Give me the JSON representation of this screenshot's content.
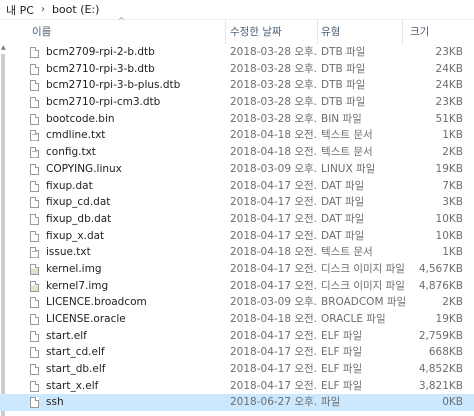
{
  "breadcrumb": [
    "내 PC",
    "boot (E:)"
  ],
  "columns": {
    "name": "이름",
    "date": "수정한 날짜",
    "type": "유형",
    "size": "크기"
  },
  "files": [
    {
      "name": "bcm2709-rpi-2-b.dtb",
      "date": "2018-03-28 오후...",
      "type": "DTB 파일",
      "size": "23KB",
      "icon": "file-icon"
    },
    {
      "name": "bcm2710-rpi-3-b.dtb",
      "date": "2018-03-28 오후...",
      "type": "DTB 파일",
      "size": "24KB",
      "icon": "file-icon"
    },
    {
      "name": "bcm2710-rpi-3-b-plus.dtb",
      "date": "2018-03-28 오후...",
      "type": "DTB 파일",
      "size": "24KB",
      "icon": "file-icon"
    },
    {
      "name": "bcm2710-rpi-cm3.dtb",
      "date": "2018-03-28 오후...",
      "type": "DTB 파일",
      "size": "23KB",
      "icon": "file-icon"
    },
    {
      "name": "bootcode.bin",
      "date": "2018-03-28 오후...",
      "type": "BIN 파일",
      "size": "51KB",
      "icon": "file-icon"
    },
    {
      "name": "cmdline.txt",
      "date": "2018-04-18 오전...",
      "type": "텍스트 문서",
      "size": "1KB",
      "icon": "text-file-icon"
    },
    {
      "name": "config.txt",
      "date": "2018-04-18 오전...",
      "type": "텍스트 문서",
      "size": "2KB",
      "icon": "text-file-icon"
    },
    {
      "name": "COPYING.linux",
      "date": "2018-03-09 오후...",
      "type": "LINUX 파일",
      "size": "19KB",
      "icon": "file-icon"
    },
    {
      "name": "fixup.dat",
      "date": "2018-04-17 오전...",
      "type": "DAT 파일",
      "size": "7KB",
      "icon": "file-icon"
    },
    {
      "name": "fixup_cd.dat",
      "date": "2018-04-17 오전...",
      "type": "DAT 파일",
      "size": "3KB",
      "icon": "file-icon"
    },
    {
      "name": "fixup_db.dat",
      "date": "2018-04-17 오전...",
      "type": "DAT 파일",
      "size": "10KB",
      "icon": "file-icon"
    },
    {
      "name": "fixup_x.dat",
      "date": "2018-04-17 오전...",
      "type": "DAT 파일",
      "size": "10KB",
      "icon": "file-icon"
    },
    {
      "name": "issue.txt",
      "date": "2018-04-18 오전...",
      "type": "텍스트 문서",
      "size": "1KB",
      "icon": "text-file-icon"
    },
    {
      "name": "kernel.img",
      "date": "2018-04-17 오전...",
      "type": "디스크 이미지 파일",
      "size": "4,567KB",
      "icon": "image-file-icon"
    },
    {
      "name": "kernel7.img",
      "date": "2018-04-17 오전...",
      "type": "디스크 이미지 파일",
      "size": "4,876KB",
      "icon": "image-file-icon"
    },
    {
      "name": "LICENCE.broadcom",
      "date": "2018-03-09 오후...",
      "type": "BROADCOM 파일",
      "size": "2KB",
      "icon": "file-icon"
    },
    {
      "name": "LICENSE.oracle",
      "date": "2018-04-18 오전...",
      "type": "ORACLE 파일",
      "size": "19KB",
      "icon": "file-icon"
    },
    {
      "name": "start.elf",
      "date": "2018-04-17 오전...",
      "type": "ELF 파일",
      "size": "2,759KB",
      "icon": "file-icon"
    },
    {
      "name": "start_cd.elf",
      "date": "2018-04-17 오전...",
      "type": "ELF 파일",
      "size": "668KB",
      "icon": "file-icon"
    },
    {
      "name": "start_db.elf",
      "date": "2018-04-17 오전...",
      "type": "ELF 파일",
      "size": "4,852KB",
      "icon": "file-icon"
    },
    {
      "name": "start_x.elf",
      "date": "2018-04-17 오전...",
      "type": "ELF 파일",
      "size": "3,821KB",
      "icon": "file-icon"
    },
    {
      "name": "ssh",
      "date": "2018-06-27 오후...",
      "type": "파일",
      "size": "0KB",
      "icon": "file-icon",
      "selected": true
    }
  ],
  "colors": {
    "header_text": "#4c607a",
    "selection": "#cce8ff",
    "secondary_text": "#6d6d6d"
  }
}
